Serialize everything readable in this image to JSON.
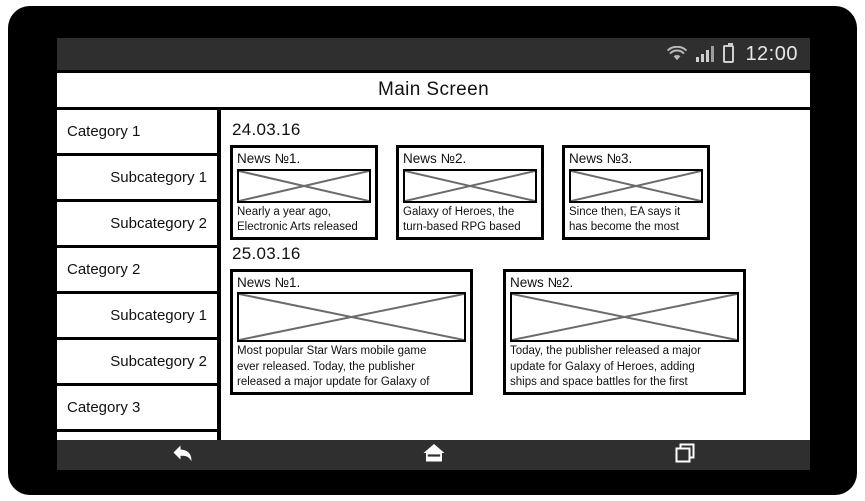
{
  "statusbar": {
    "wifi_icon": "wifi-icon",
    "signal_icon": "signal-bars-icon",
    "battery_icon": "battery-icon",
    "time": "12:00"
  },
  "header": {
    "title": "Main Screen"
  },
  "sidebar": {
    "items": [
      {
        "label": "Category 1",
        "type": "category"
      },
      {
        "label": "Subcategory 1",
        "type": "subcategory"
      },
      {
        "label": "Subcategory 2",
        "type": "subcategory"
      },
      {
        "label": "Category 2",
        "type": "category"
      },
      {
        "label": "Subcategory 1",
        "type": "subcategory"
      },
      {
        "label": "Subcategory 2",
        "type": "subcategory"
      },
      {
        "label": "Category 3",
        "type": "category"
      }
    ]
  },
  "content": {
    "groups": [
      {
        "date": "24.03.16",
        "cards": [
          {
            "title": "News №1.",
            "image_placeholder": "crossed-image-placeholder",
            "lines": [
              "Nearly a year ago,",
              "Electronic Arts released"
            ]
          },
          {
            "title": "News №2.",
            "image_placeholder": "crossed-image-placeholder",
            "lines": [
              "Galaxy of Heroes, the",
              "turn-based RPG based"
            ]
          },
          {
            "title": "News №3.",
            "image_placeholder": "crossed-image-placeholder",
            "lines": [
              "Since then, EA says it",
              "has become the most"
            ]
          }
        ]
      },
      {
        "date": "25.03.16",
        "cards": [
          {
            "title": "News №1.",
            "image_placeholder": "crossed-image-placeholder",
            "lines": [
              "Most popular Star Wars mobile game",
              "ever released. Today, the publisher",
              "released a major update for Galaxy of"
            ]
          },
          {
            "title": "News №2.",
            "image_placeholder": "crossed-image-placeholder",
            "lines": [
              "Today, the publisher released a major",
              "update for Galaxy of Heroes, adding",
              "ships and space battles for the first"
            ]
          }
        ]
      }
    ]
  },
  "navbar": {
    "buttons": [
      {
        "name": "back-icon"
      },
      {
        "name": "home-icon"
      },
      {
        "name": "recents-icon"
      }
    ]
  },
  "colors": {
    "bezel": "#000000",
    "statusbar_bg": "#2f2f2f",
    "statusbar_fg": "#e8e8e8",
    "screen_bg": "#ffffff",
    "outline": "#000000",
    "placeholder_stroke": "#6b6b6b"
  }
}
